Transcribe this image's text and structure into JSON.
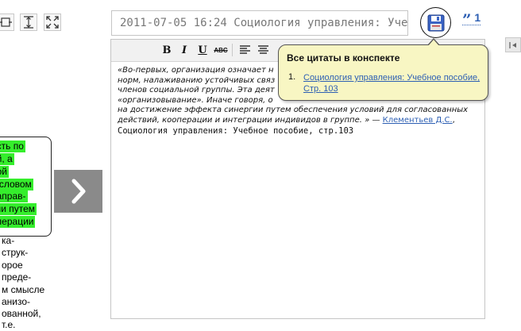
{
  "toolbar_icons": [
    "fit-width-icon",
    "fit-height-icon",
    "fullscreen-icon"
  ],
  "left_text": {
    "highlighted_lines": [
      "ость по",
      "ей, а",
      "ной",
      "я словом",
      "направ-",
      "тии путем",
      "операции"
    ],
    "plain_lines": [
      "ка-",
      "струк-",
      "орое",
      "преде-",
      "м смысле",
      "анизо-",
      "ованной,",
      "т.е."
    ]
  },
  "next_arrow_glyph": "❯",
  "title_input_value": "2011-07-05 16:24 Социология управления: Уче",
  "save_icon": "floppy-disk-icon",
  "quote_count": {
    "glyph": "”",
    "count": "1"
  },
  "editor": {
    "toolbar": {
      "bold": "B",
      "italic": "I",
      "underline": "U",
      "strike": "ABC"
    },
    "body": {
      "quote_lines": [
        "«Во-первых, организация означает н",
        "норм, налаживанию устойчивых связ",
        "членов социальной группы. Эта деят",
        "«организовывание». Иначе говоря, о",
        "на достижение эффекта синергии путем обеспечения условий для согласованных",
        "действий, кооперации и интеграции индивидов в группе. » — "
      ],
      "author": "Клементьев Д.С.",
      "after_author": ",",
      "source": "Социология управления: Учебное пособие, стр.103"
    }
  },
  "popup": {
    "title": "Все цитаты в конспекте",
    "items": [
      {
        "number": "1.",
        "text": "Социология управления: Учебное пособие, Стр. 103"
      }
    ]
  },
  "colors": {
    "highlight": "#35ee2c",
    "link": "#2d5fb3",
    "popup_bg": "#f8f6c3",
    "arrow_bg": "#8a8a8a"
  }
}
